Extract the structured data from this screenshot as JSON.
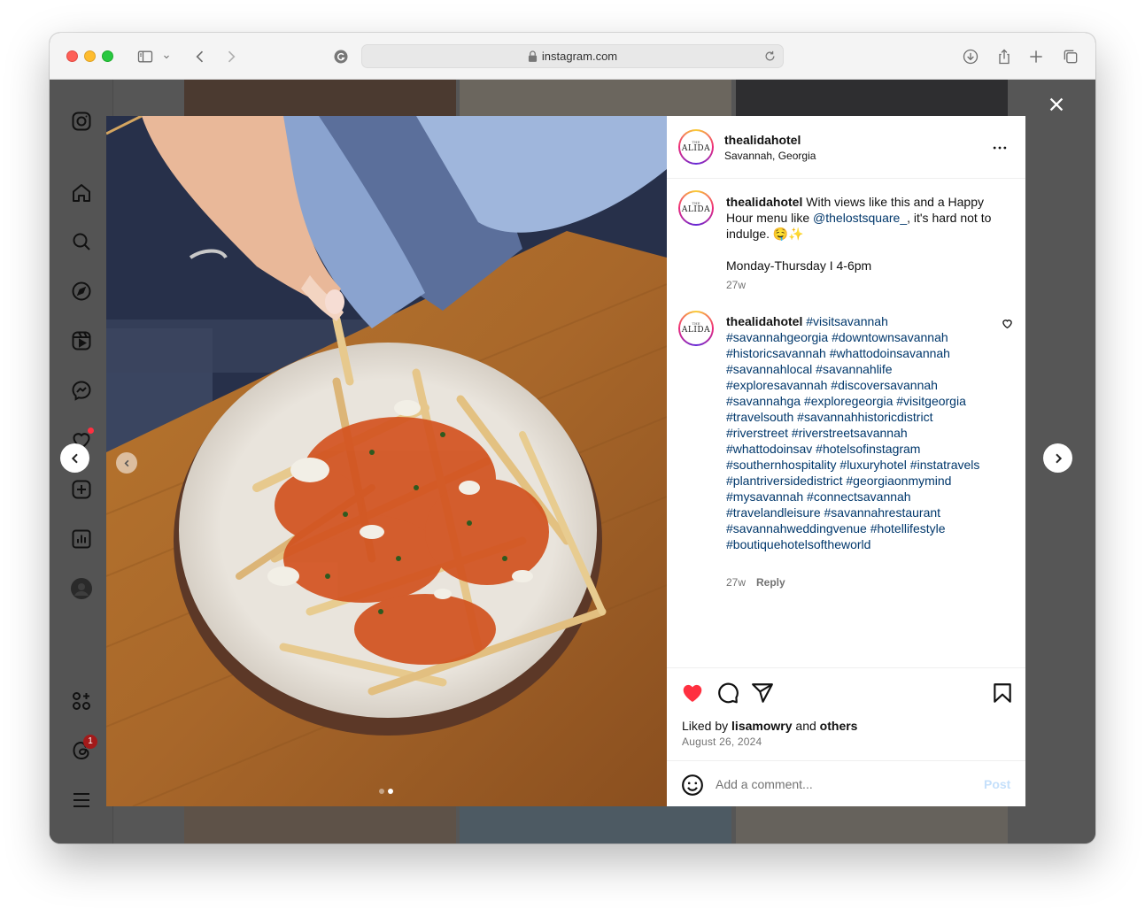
{
  "browser": {
    "url": "instagram.com",
    "icons": [
      "sidebar-toggle-icon",
      "chevron-down-icon",
      "back-icon",
      "forward-icon",
      "grammarly-icon",
      "lock-icon",
      "reload-icon",
      "download-icon",
      "share-icon",
      "new-tab-icon",
      "tabs-overview-icon"
    ]
  },
  "sidebar": {
    "icons": [
      "instagram-logo-icon",
      "home-icon",
      "search-icon",
      "explore-icon",
      "reels-icon",
      "messenger-icon",
      "notifications-heart-icon",
      "create-icon",
      "dashboard-icon",
      "profile-avatar",
      "also-from-meta-icon",
      "threads-icon",
      "more-menu-icon"
    ],
    "threads_badge": "1"
  },
  "post": {
    "account": {
      "username": "thealidahotel",
      "location": "Savannah, Georgia",
      "avatar_text_small": "THE",
      "avatar_text": "ALIDA"
    },
    "caption": {
      "username": "thealidahotel",
      "text_before": " With views like this and a Happy Hour menu like ",
      "mention": "@thelostsquare_",
      "text_after": ", it's hard not to indulge. 🤤✨",
      "hours": "Monday-Thursday I 4-6pm",
      "time": "27w"
    },
    "hashtag_comment": {
      "username": "thealidahotel",
      "hashtags": "#visitsavannah #savannahgeorgia #downtownsavannah #historicsavannah #whattodoinsavannah #savannahlocal #savannahlife #exploresavannah #discoversavannah #savannahga #exploregeorgia #visitgeorgia #travelsouth #savannahhistoricdistrict #riverstreet #riverstreetsavannah #whattodoinsav #hotelsofinstagram #southernhospitality #luxuryhotel #instatravels #plantriversidedistrict #georgiaonmymind #mysavannah #connectsavannah #travelandleisure #savannahrestaurant #savannahweddingvenue #hotellifestyle #boutiquehotelsoftheworld",
      "time": "27w",
      "reply_label": "Reply"
    },
    "likes": {
      "prefix": "Liked by ",
      "user": "lisamowry",
      "middle": " and ",
      "others": "others"
    },
    "date": "August 26, 2024",
    "comment_input_placeholder": "Add a comment...",
    "post_button": "Post",
    "liked": true
  },
  "colors": {
    "like_red": "#ff3040",
    "link_blue": "#00376b",
    "post_disabled": "#c5e0fb"
  }
}
